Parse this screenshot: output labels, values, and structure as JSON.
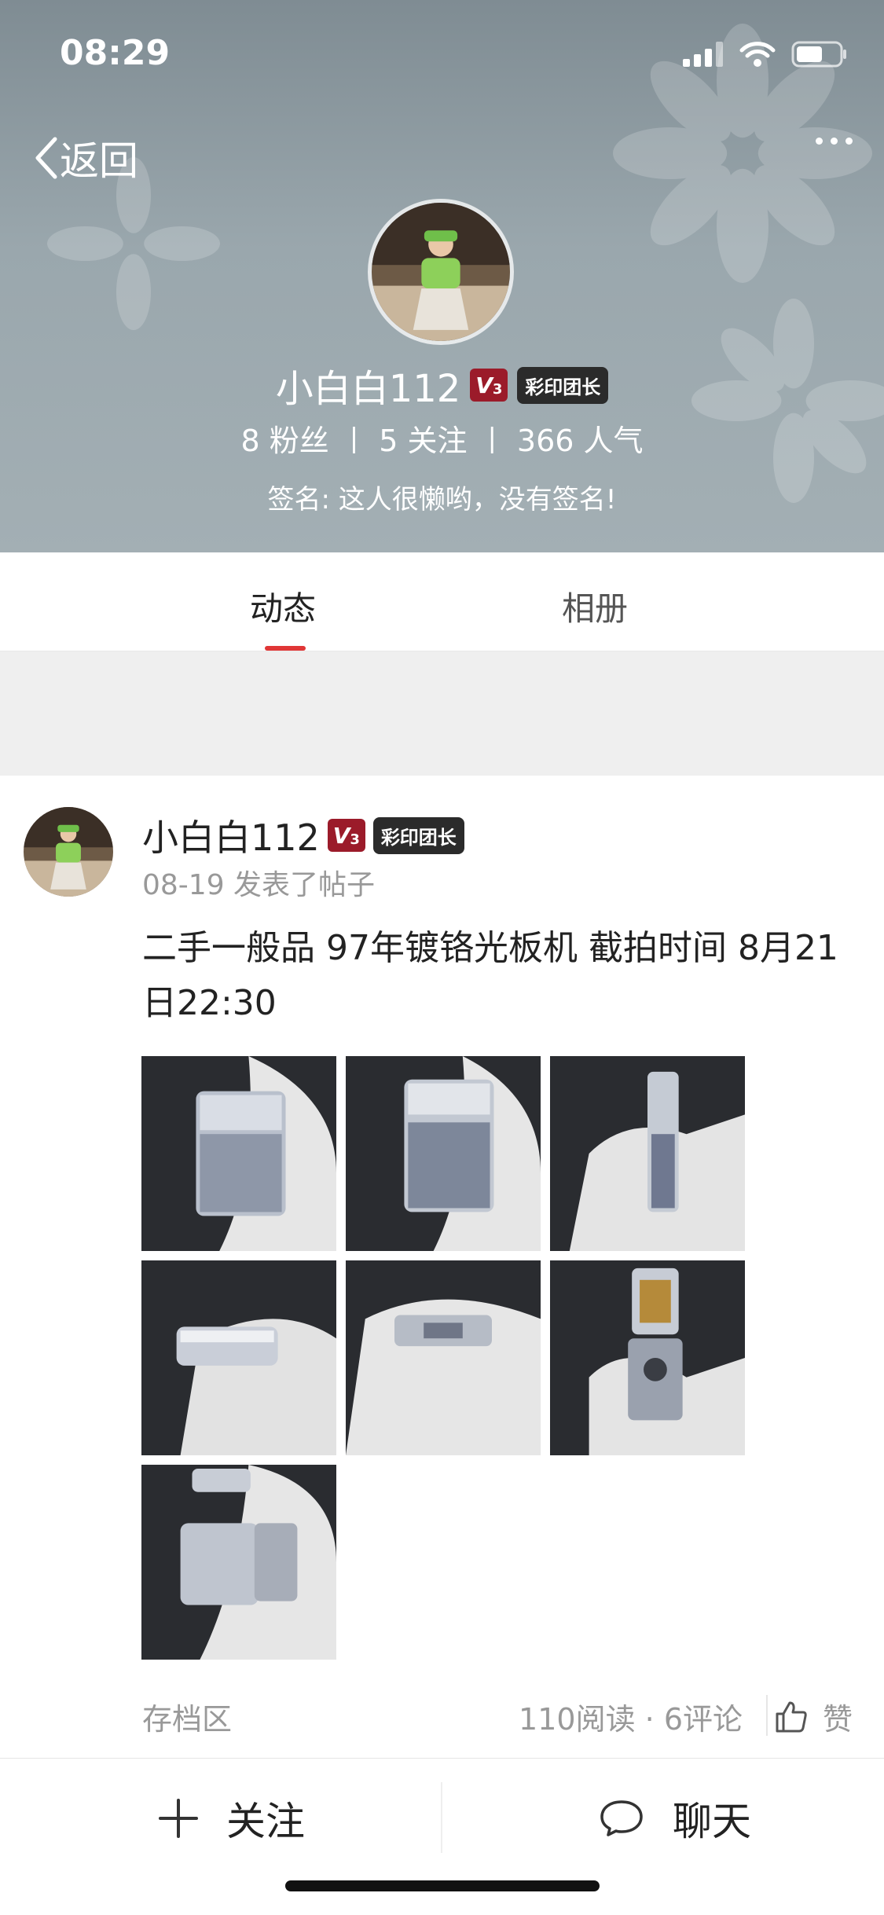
{
  "status_bar": {
    "time": "08:29"
  },
  "nav": {
    "back_label": "返回"
  },
  "profile": {
    "name": "小白白112",
    "level_badge": "V",
    "level_number": "3",
    "role_badge": "彩印团长",
    "fans": "8 粉丝",
    "following": "5 关注",
    "popularity": "366 人气",
    "signature": "签名: 这人很懒哟，没有签名!"
  },
  "tabs": [
    {
      "label": "动态",
      "active": true
    },
    {
      "label": "相册",
      "active": false
    }
  ],
  "post": {
    "author": "小白白112",
    "level_badge": "V",
    "level_number": "3",
    "role_badge": "彩印团长",
    "meta": "08-19 发表了帖子",
    "text": "二手一般品 97年镀铬光板机 截拍时间 8月21日22:30",
    "photo_count": 7,
    "archive_label": "存档区",
    "stats": "110阅读 · 6评论",
    "like_label": "赞"
  },
  "bottom_bar": {
    "follow_label": "关注",
    "chat_label": "聊天"
  },
  "colors": {
    "accent_red": "#e03636",
    "level_badge_bg": "#9b1b2a",
    "role_badge_bg": "#2b2b2b"
  },
  "icons": [
    "back-chevron-icon",
    "more-dots-icon",
    "signal-icon",
    "wifi-icon",
    "battery-icon",
    "thumbs-up-icon",
    "plus-icon",
    "chat-bubble-icon"
  ]
}
